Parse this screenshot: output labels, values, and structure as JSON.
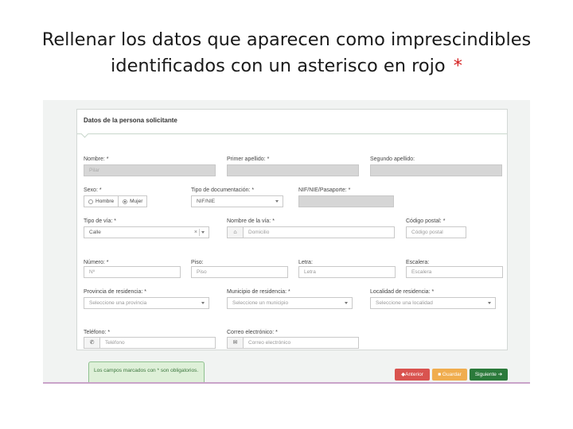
{
  "slide": {
    "title_line1": "Rellenar los datos que aparecen como imprescindibles",
    "title_line2": "identificados con un asterisco en rojo",
    "asterisk": "*"
  },
  "form": {
    "section_title": "Datos de la persona solicitante",
    "fields": {
      "nombre": {
        "label": "Nombre: *",
        "value": "Pilar"
      },
      "primer_apellido": {
        "label": "Primer apellido: *",
        "value": ""
      },
      "segundo_apellido": {
        "label": "Segundo apellido:",
        "value": ""
      },
      "sexo": {
        "label": "Sexo: *",
        "options": [
          "Hombre",
          "Mujer"
        ],
        "selected": "Mujer"
      },
      "tipo_documento": {
        "label": "Tipo de documentación: *",
        "value": "NIF/NIE"
      },
      "nif": {
        "label": "NIF/NIE/Pasaporte: *",
        "value": ""
      },
      "tipo_via": {
        "label": "Tipo de vía: *",
        "value": "Calle",
        "clear": "×"
      },
      "nombre_via": {
        "label": "Nombre de la vía: *",
        "placeholder": "Domicilio",
        "icon": "home-icon",
        "icon_glyph": "⌂"
      },
      "codigo_postal": {
        "label": "Código postal: *",
        "placeholder": "Código postal"
      },
      "numero": {
        "label": "Número: *",
        "placeholder": "Nº"
      },
      "piso": {
        "label": "Piso:",
        "placeholder": "Piso"
      },
      "letra": {
        "label": "Letra:",
        "placeholder": "Letra"
      },
      "escalera": {
        "label": "Escalera:",
        "placeholder": "Escalera"
      },
      "provincia": {
        "label": "Provincia de residencia: *",
        "placeholder": "Seleccione una provincia"
      },
      "municipio": {
        "label": "Municipio de residencia: *",
        "placeholder": "Seleccione un municipio"
      },
      "localidad": {
        "label": "Localidad de residencia: *",
        "placeholder": "Seleccione una localidad"
      },
      "telefono": {
        "label": "Teléfono: *",
        "placeholder": "Teléfono",
        "icon": "phone-icon",
        "icon_glyph": "✆"
      },
      "correo": {
        "label": "Correo electrónico: *",
        "placeholder": "Correo electrónico",
        "icon": "envelope-icon",
        "icon_glyph": "✉"
      }
    },
    "note": "Los campos marcados con * son obligatorios.",
    "buttons": {
      "anterior": "◆Anterior",
      "guardar": "■ Guardar",
      "siguiente": "Siguiente ➔"
    },
    "colors": {
      "anterior": "#d9534f",
      "guardar": "#f0ad4e",
      "siguiente": "#2b7a3b",
      "asterisk": "#d42020"
    }
  }
}
